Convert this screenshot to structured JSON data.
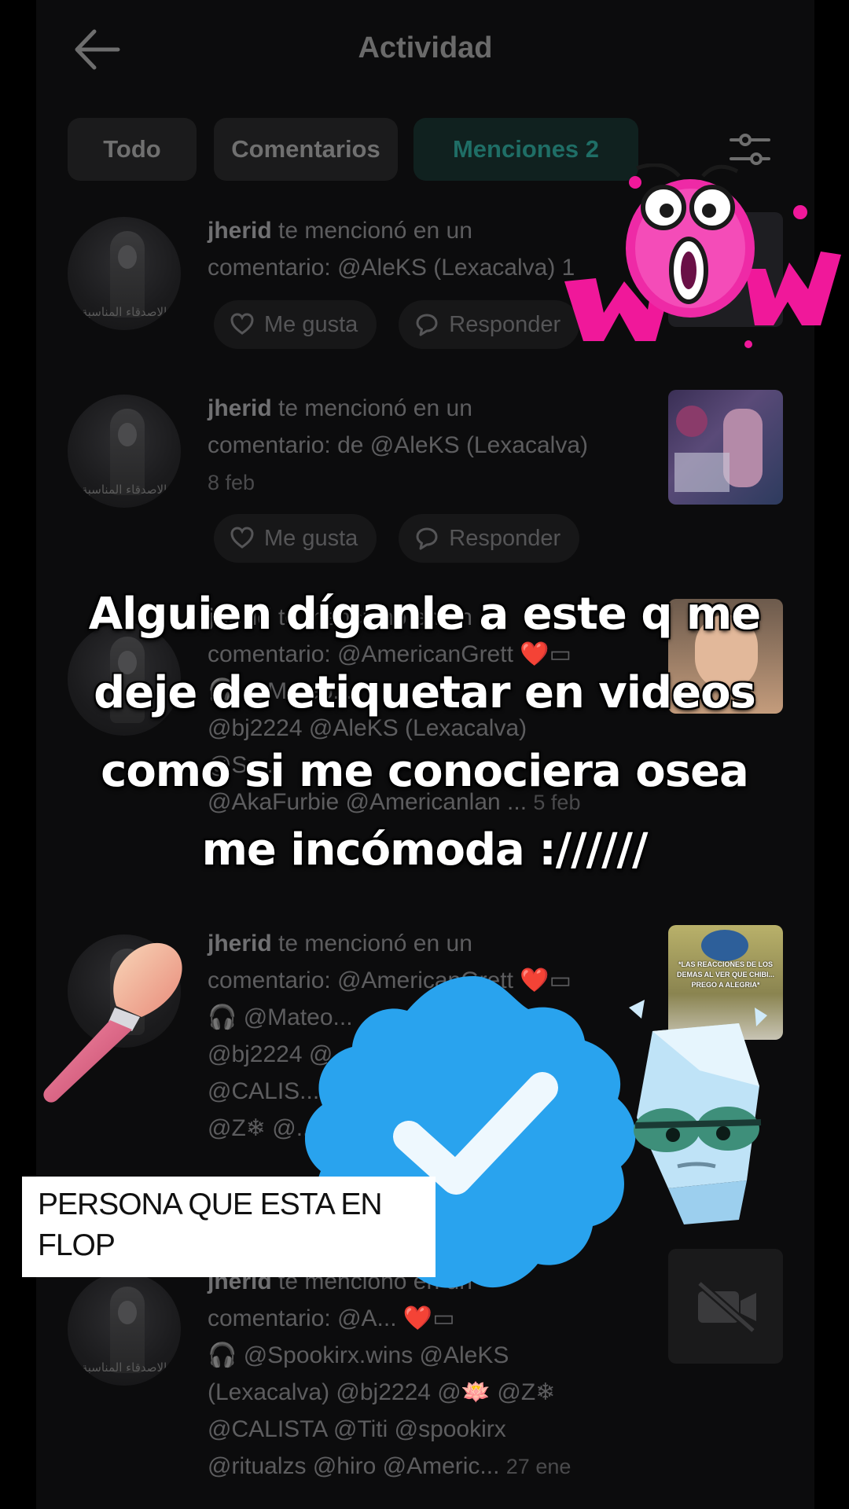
{
  "header": {
    "title": "Actividad"
  },
  "tabs": [
    {
      "label": "Todo",
      "active": false
    },
    {
      "label": "Comentarios",
      "active": false
    },
    {
      "label": "Menciones 2",
      "active": true
    }
  ],
  "avatar_text": "الاصدقاء المناسبة",
  "notifications": [
    {
      "user": "jherid",
      "lines": [
        "te mencionó en un",
        "comentario: @AleKS (Lexacalva) 1"
      ],
      "date": "",
      "has_actions": true
    },
    {
      "user": "jherid",
      "lines": [
        "te mencionó en un",
        "comentario: de @AleKS (Lexacalva)"
      ],
      "date": "8 feb",
      "has_actions": true
    },
    {
      "user": "jherid",
      "lines": [
        "te mencionó en un",
        "comentario: @AmericanGrett ❤️▭",
        "🎧 @Mateo...",
        "@bj2224 @AleKS (Lexacalva)",
        "@Sp...",
        "@AkaFurbie @Americanlan ..."
      ],
      "date": "5 feb",
      "has_actions": false
    },
    {
      "user": "jherid",
      "lines": [
        "te mencionó en un",
        "comentario: @AmericanGrett ❤️▭",
        "🎧 @Mateo...",
        "@bj2224 @...",
        "@CALIS...",
        "@Z❄ @..."
      ],
      "date": "",
      "has_actions": false
    },
    {
      "user": "jherid",
      "lines": [
        "te mencionó en un",
        "comentario: @A... ❤️▭",
        "🎧 @Spookirx.wins @AleKS",
        "(Lexacalva) @bj2224 @🪷 @Z❄",
        "@CALISTA @Titi @spookirx",
        "@ritualzs @hiro @Americ..."
      ],
      "date": "27 ene",
      "has_actions": false
    }
  ],
  "actions": {
    "like": "Me gusta",
    "reply": "Responder"
  },
  "thumbnails": {
    "post4_caption": "*LAS REACCIONES DE LOS DEMAS AL VER QUE CHIBI... PREGO A ALEGRIA*"
  },
  "overlay": {
    "caption_lines": [
      "Alguien díganle a este q me",
      "deje de etiquetar en videos",
      "como si me conociera osea",
      "me incómoda ://////"
    ],
    "label_lines": [
      "PERSONA QUE ESTA EN",
      "FLOP"
    ]
  },
  "stickers": [
    "wow-sticker",
    "makeup-brush-icon",
    "verified-badge-icon",
    "embarrassment-character"
  ],
  "colors": {
    "background": "#0c0c0d",
    "active_tab_text": "#1f6e66",
    "verified_blue": "#29a3ee",
    "wow_pink": "#f0189a"
  }
}
